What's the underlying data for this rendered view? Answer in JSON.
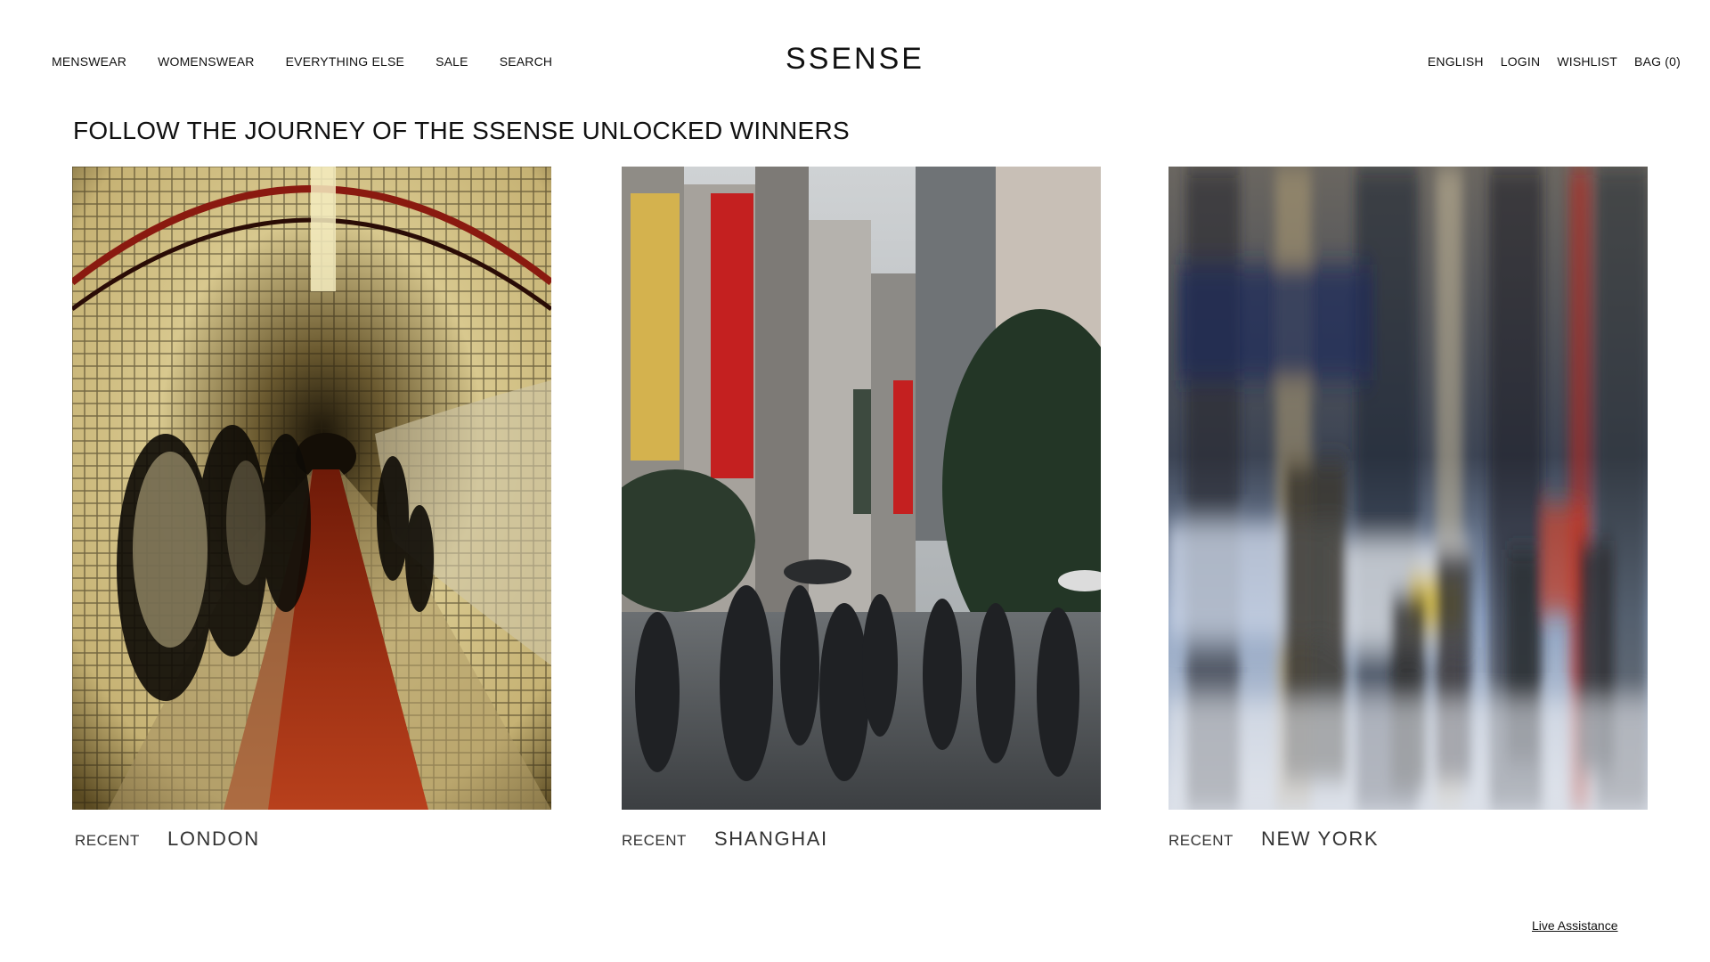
{
  "header": {
    "logo": "SSENSE",
    "nav_left": [
      "MENSWEAR",
      "WOMENSWEAR",
      "EVERYTHING ELSE",
      "SALE",
      "SEARCH"
    ],
    "nav_right": [
      "ENGLISH",
      "LOGIN",
      "WISHLIST",
      "BAG (0)"
    ]
  },
  "main": {
    "title": "FOLLOW THE JOURNEY OF THE SSENSE UNLOCKED WINNERS",
    "cards": [
      {
        "tag": "RECENT",
        "city": "LONDON"
      },
      {
        "tag": "RECENT",
        "city": "SHANGHAI"
      },
      {
        "tag": "RECENT",
        "city": "NEW YORK"
      }
    ]
  },
  "footer": {
    "live_assistance": "Live Assistance"
  }
}
